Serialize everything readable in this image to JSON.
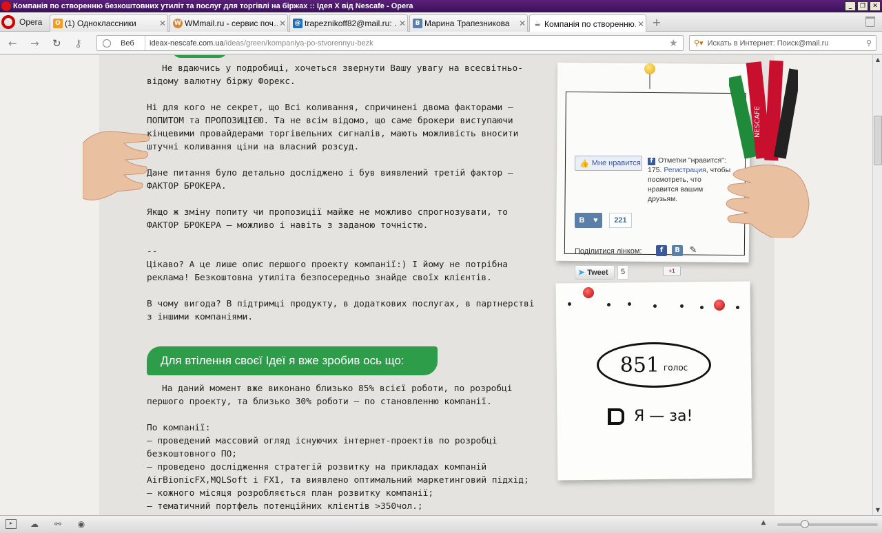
{
  "window": {
    "title": "Компанія по створенню безкоштовних утиліт та послуг для торгівлі на біржах :: Ідея X від Nescafe - Opera",
    "controls": [
      "_",
      "❐",
      "✕"
    ]
  },
  "opera_button": {
    "label": "Opera"
  },
  "tabs": [
    {
      "label": "(1) Одноклассники",
      "favicon": "О",
      "color": "#f59b1f"
    },
    {
      "label": "WMmail.ru - сервис поч…",
      "favicon": "W",
      "color": "#d6863a"
    },
    {
      "label": "trapeznikoff82@mail.ru: …",
      "favicon": "@",
      "color": "#1c6fb8"
    },
    {
      "label": "Марина Трапезникова",
      "favicon": "B",
      "color": "#5b7fa6"
    },
    {
      "label": "Компанія по створенню…",
      "favicon": "☕",
      "color": "#333333"
    }
  ],
  "new_tab": "+",
  "nav": {
    "back": "←",
    "forward": "→",
    "reload": "↻",
    "key": "⚷",
    "address_prefix": "Веб",
    "url_host": "ideax-nescafe.com.ua",
    "url_path": "/ideas/green/kompaniya-po-stvorennyu-bezk",
    "star": "★",
    "search_placeholder": "Искать в Интернет: Поиск@mail.ru"
  },
  "article": {
    "p1": "Не вдаючись у подробиці, хочеться звернути Вашу увагу на всесвітньо-відому валютну біржу Форекс.",
    "p2": "Ні для кого не секрет, що Всі коливання, спричинені двома факторами – ПОПИТОМ та ПРОПОЗИЦІЄЮ. Та не всім відомо, що саме брокери виступаючи кінцевими провайдерами торгівельних сигналів, мають можливість вносити штучні коливання ціни на власний розсуд.",
    "p3": "Дане питання було детально досліджено і був виявлений третій фактор – ФАКТОР БРОКЕРА.",
    "p4": "Якщо ж зміну попиту чи пропозиції майже не можливо спрогнозувати, то ФАКТОР БРОКЕРА – можливо і навіть з заданою точністю.",
    "p5a": "--",
    "p5b": "Цікаво? А це лише опис першого проекту компанії:) І йому не потрібна реклама! Безкоштовна утиліта безпосередньо знайде своїх клієнтів.",
    "p6": "В чому вигода? В підтримці продукту, в додаткових послугах, в партнерстві з іншими компаніями.",
    "banner": "Для втілення своєї Ідеї я вже зробив ось що:",
    "p7": "На даний момент вже виконано близько 85% всієї роботи, по розробці першого проекту, та близько 30% роботи – по становленню компанії.",
    "list_title": "По компанії:",
    "list": [
      "– проведений массовий огляд існуючих інтернет-проектів по розробці безкоштовного ПО;",
      "– проведено дослідження стратегій розвитку на прикладах компаній AirBionicFX,MQLSoft і FX1, та виявлено оптимальний маркетинговий підхід;",
      "– кожного місяця розробляється план розвитку компанії;",
      "– тематичний портфель потенційних клієнтів >350чол.;"
    ]
  },
  "social": {
    "fb_button": "Мне нравится",
    "fb_text_1": "Отметки \"нравится\": 175.",
    "fb_link": "Регистрация",
    "fb_text_2": ", чтобы посмотреть, что нравится вашим друзьям.",
    "vk_label": "В",
    "vk_count": "221",
    "share_label": "Поділитися лінком:",
    "tweet_label": "Tweet",
    "tweet_count": "5",
    "gplus": "+1"
  },
  "vote": {
    "count": "851",
    "count_word": "голос",
    "cta": "Я — за!"
  },
  "colors": {
    "banner_green": "#2e9d4a",
    "facebook_blue": "#3b5998",
    "vk_blue": "#5b7fa6",
    "pin_red": "#b40d0d",
    "pin_yellow": "#e2a90f"
  }
}
